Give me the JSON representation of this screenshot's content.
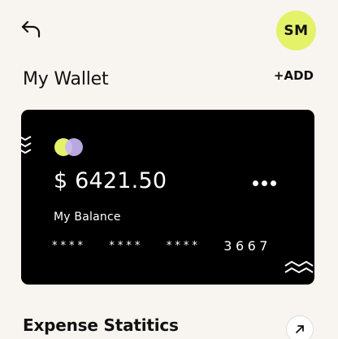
{
  "header": {
    "back_icon": "arrow-uturn-left-icon",
    "avatar_initials": "SM",
    "avatar_color": "#e4f26a"
  },
  "wallet": {
    "title": "My Wallet",
    "add_label": "+ADD"
  },
  "card": {
    "background": "#000000",
    "balance": "$ 6421.50",
    "balance_label": "My Balance",
    "masked_groups": [
      "****",
      "****",
      "****"
    ],
    "last_four": "3667",
    "logo_colors": [
      "#e4f26a",
      "#c9b6f2"
    ]
  },
  "expense": {
    "title": "Expense Statitics",
    "expand_icon": "arrow-up-right-icon"
  }
}
